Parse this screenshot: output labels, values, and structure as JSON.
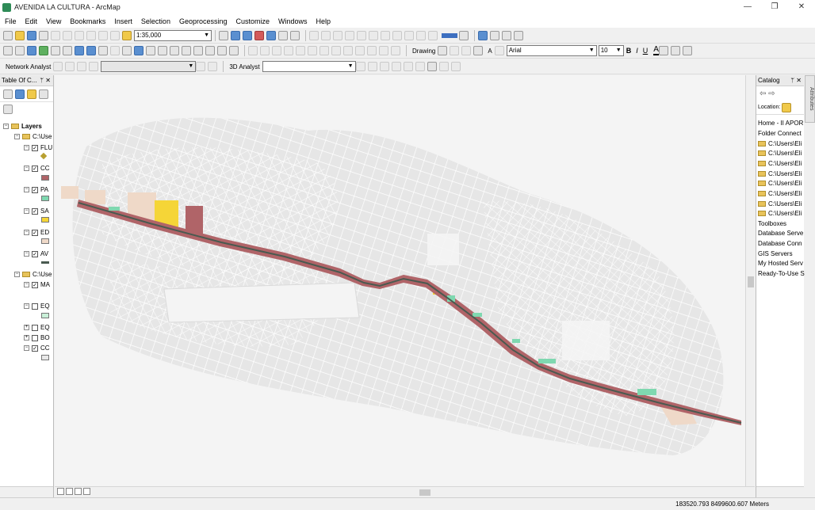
{
  "window": {
    "title": "AVENIDA LA CULTURA - ArcMap",
    "minimize_glyph": "—",
    "maximize_glyph": "❐",
    "close_glyph": "✕"
  },
  "menu": [
    "File",
    "Edit",
    "View",
    "Bookmarks",
    "Insert",
    "Selection",
    "Geoprocessing",
    "Customize",
    "Windows",
    "Help"
  ],
  "toolbar": {
    "scale_value": "1:35,000",
    "drawing_label": "Drawing",
    "font_name": "Arial",
    "font_size": "10",
    "bold": "B",
    "italic": "I",
    "underline": "U",
    "font_color_glyph": "A",
    "text_tool_glyph": "A",
    "network_analyst_label": "Network Analyst",
    "analyst_3d_label": "3D Analyst"
  },
  "toc": {
    "title": "Table Of C...",
    "pin_glyph": "ᛘ",
    "close_glyph": "✕",
    "root": "Layers",
    "group1": "C:\\Use",
    "group2": "C:\\Use",
    "layers": [
      "FLU",
      "CC",
      "PA",
      "SA",
      "ED",
      "AV",
      "MA",
      "EQ",
      "EQ",
      "BO",
      "CC"
    ],
    "layer_checked": [
      true,
      true,
      true,
      true,
      true,
      true,
      true,
      false,
      false,
      false,
      true
    ]
  },
  "catalog": {
    "title": "Catalog",
    "pin_glyph": "ᛘ",
    "close_glyph": "✕",
    "location_label": "Location:",
    "items": [
      "Home - II APOR",
      "Folder Connect",
      "C:\\Users\\Eli",
      "C:\\Users\\Eli",
      "C:\\Users\\Eli",
      "C:\\Users\\Eli",
      "C:\\Users\\Eli",
      "C:\\Users\\Eli",
      "C:\\Users\\Eli",
      "C:\\Users\\Eli",
      "Toolboxes",
      "Database Serve",
      "Database Conn",
      "GIS Servers",
      "My Hosted Serv",
      "Ready-To-Use S"
    ],
    "item_is_folder": [
      false,
      false,
      true,
      true,
      true,
      true,
      true,
      true,
      true,
      true,
      false,
      false,
      false,
      false,
      false,
      false
    ]
  },
  "side_tab": "Attributes",
  "status": {
    "coordinates": "183520.793  8499600.607 Meters"
  },
  "colors": {
    "avenue_block": "#b06468",
    "avenue_line": "#4a5a50",
    "green_area": "#7fd8b0",
    "yellow_area": "#f5d537",
    "peach_area": "#efd9c8",
    "street_lines": "#ffffff",
    "map_bg": "#f4f4f4",
    "flu_swatch": "#b8a030",
    "cc_swatch": "#b06468",
    "pa_swatch": "#7fd8b0",
    "sa_swatch": "#f5d537",
    "ed_swatch": "#efd9c8",
    "av_swatch": "#4a5a50",
    "eq_swatch": "#c9f0d8",
    "cc2_swatch": "#e8e8e8"
  },
  "icons": [
    "new-doc-icon",
    "open-icon",
    "save-icon",
    "print-icon",
    "cut-icon",
    "copy-icon",
    "paste-icon",
    "delete-icon",
    "undo-icon",
    "redo-icon",
    "add-data-icon",
    "zoom-in-icon",
    "zoom-out-icon",
    "pan-icon",
    "full-extent-icon",
    "select-icon",
    "identify-icon",
    "find-icon",
    "measure-icon"
  ]
}
